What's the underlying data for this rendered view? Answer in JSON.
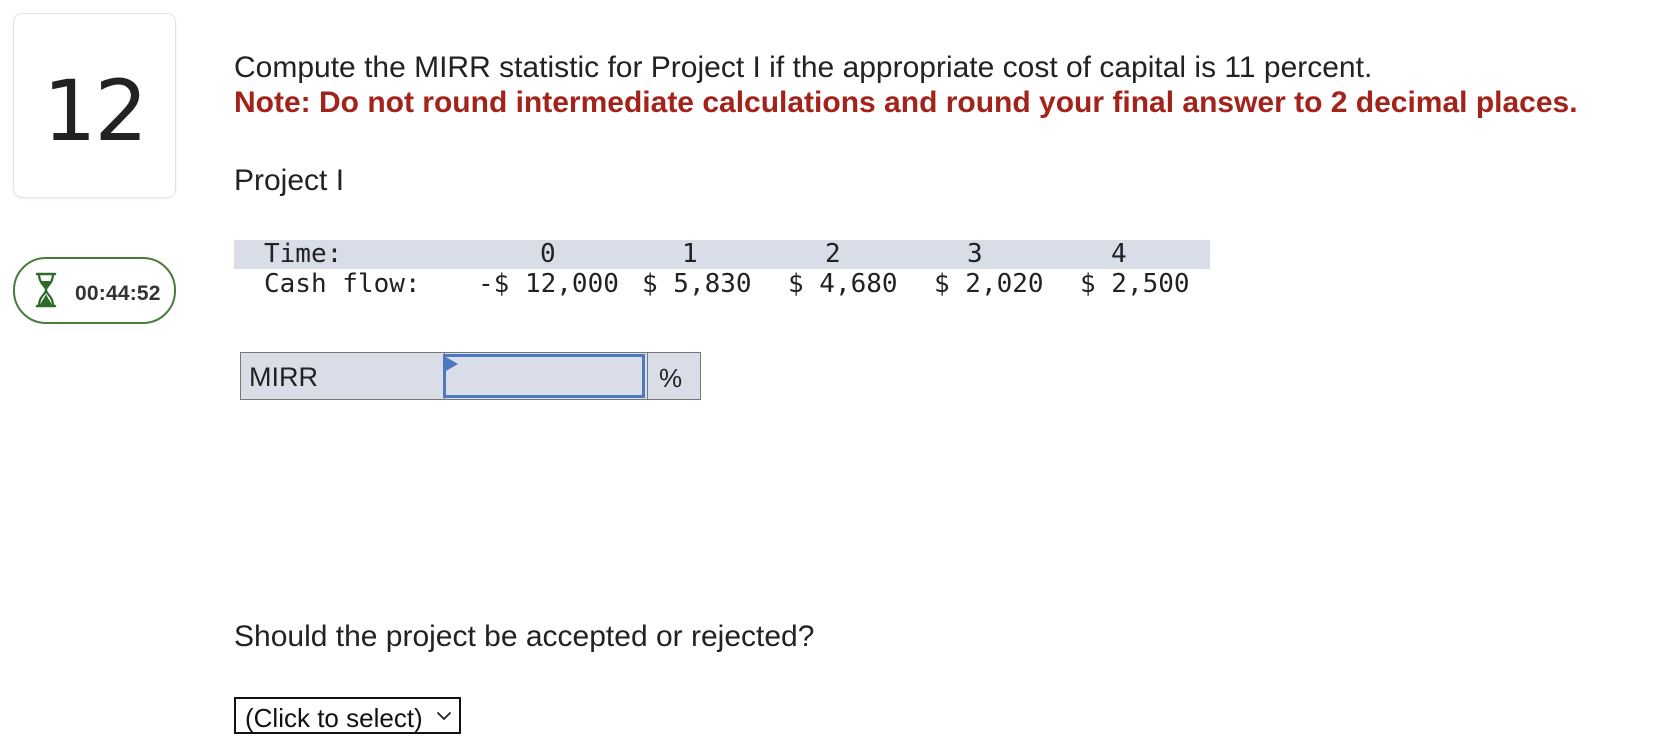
{
  "question": {
    "number": "12",
    "prompt": "Compute the MIRR statistic for Project I if the appropriate cost of capital is 11 percent.",
    "note": "Note: Do not round intermediate calculations and round your final answer to 2 decimal places.",
    "project_title": "Project I"
  },
  "timer": {
    "icon": "hourglass-icon",
    "value": "00:44:52",
    "color": "#4a7b3b"
  },
  "cash_flow_table": {
    "time_label": "Time:",
    "flow_label": "Cash flow:",
    "times": [
      "0",
      "1",
      "2",
      "3",
      "4"
    ],
    "flows": [
      "-$ 12,000",
      "$ 5,830",
      "$ 4,680",
      "$ 2,020",
      "$ 2,500"
    ]
  },
  "mirr": {
    "label": "MIRR",
    "value": "",
    "unit": "%"
  },
  "decision": {
    "question": "Should the project be accepted or rejected?",
    "select_value": "(Click to select)",
    "icon": "chevron-down-icon"
  },
  "colors": {
    "note_red": "#a3221a",
    "table_band": "#d9dde7",
    "input_focus": "#4d79c1"
  }
}
